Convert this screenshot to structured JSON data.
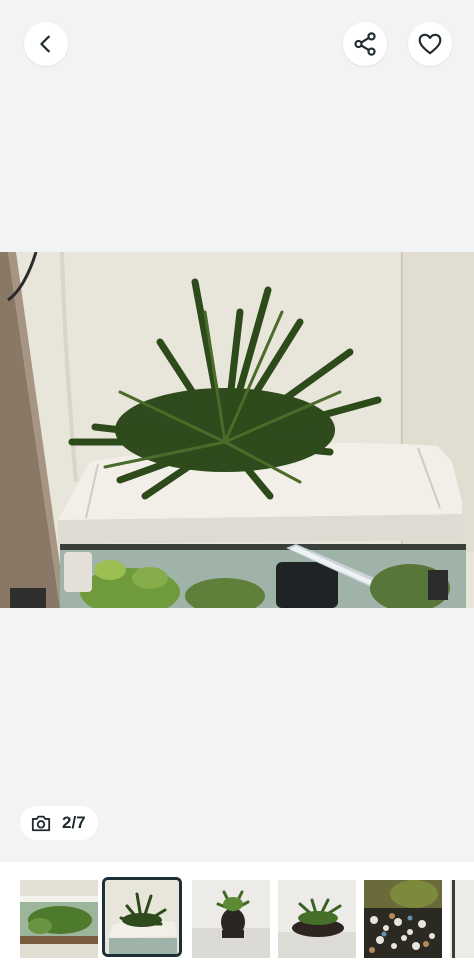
{
  "header": {
    "back_icon": "chevron-left-icon",
    "share_icon": "share-icon",
    "favorite_icon": "heart-icon"
  },
  "gallery": {
    "counter_icon": "camera-icon",
    "counter_text": "2/7",
    "current_index": 2,
    "total": 7
  },
  "thumbnails": [
    {
      "name": "thumbnail-1",
      "selected": false
    },
    {
      "name": "thumbnail-2",
      "selected": true
    },
    {
      "name": "thumbnail-3",
      "selected": false
    },
    {
      "name": "thumbnail-4",
      "selected": false
    },
    {
      "name": "thumbnail-5",
      "selected": false
    },
    {
      "name": "thumbnail-6",
      "selected": false
    }
  ],
  "colors": {
    "background": "#f1f3f4",
    "selected_border": "#1f2f3a",
    "icon": "#1f2a2e"
  }
}
